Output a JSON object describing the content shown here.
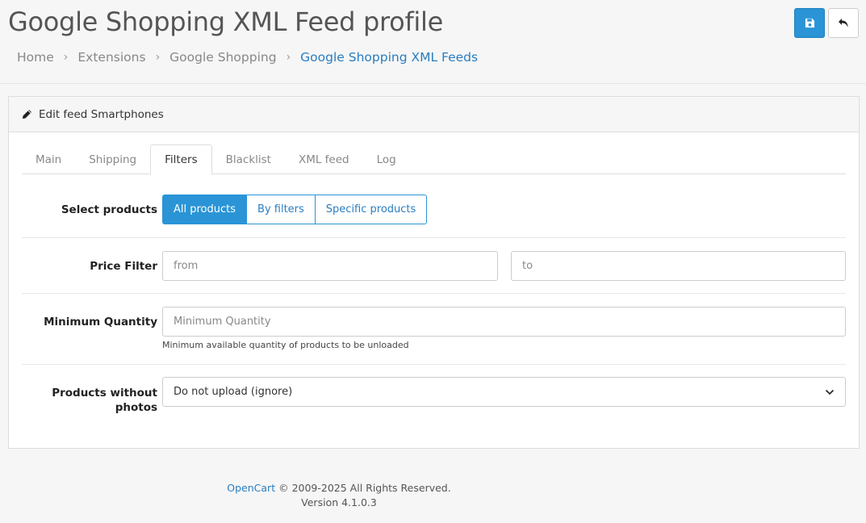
{
  "header": {
    "title": "Google Shopping XML Feed profile",
    "breadcrumb": [
      "Home",
      "Extensions",
      "Google Shopping",
      "Google Shopping XML Feeds"
    ],
    "save_icon": "save-icon",
    "back_icon": "reply-icon"
  },
  "card": {
    "icon": "pencil-icon",
    "title": "Edit feed Smartphones"
  },
  "tabs": [
    {
      "label": "Main"
    },
    {
      "label": "Shipping"
    },
    {
      "label": "Filters",
      "active": true
    },
    {
      "label": "Blacklist"
    },
    {
      "label": "XML feed"
    },
    {
      "label": "Log"
    }
  ],
  "form": {
    "select_products": {
      "label": "Select products",
      "options": [
        "All products",
        "By filters",
        "Specific products"
      ],
      "selected": "All products"
    },
    "price_filter": {
      "label": "Price Filter",
      "from_placeholder": "from",
      "to_placeholder": "to"
    },
    "min_quantity": {
      "label": "Minimum Quantity",
      "placeholder": "Minimum Quantity",
      "help": "Minimum available quantity of products to be unloaded"
    },
    "without_photos": {
      "label_line1": "Products without",
      "label_line2": "photos",
      "value": "Do not upload (ignore)"
    }
  },
  "footer": {
    "brand": "OpenCart",
    "copyright": "© 2009-2025 All Rights Reserved.",
    "version": "Version 4.1.0.3"
  },
  "colors": {
    "accent": "#2a94d6",
    "link": "#2a7ec0"
  }
}
